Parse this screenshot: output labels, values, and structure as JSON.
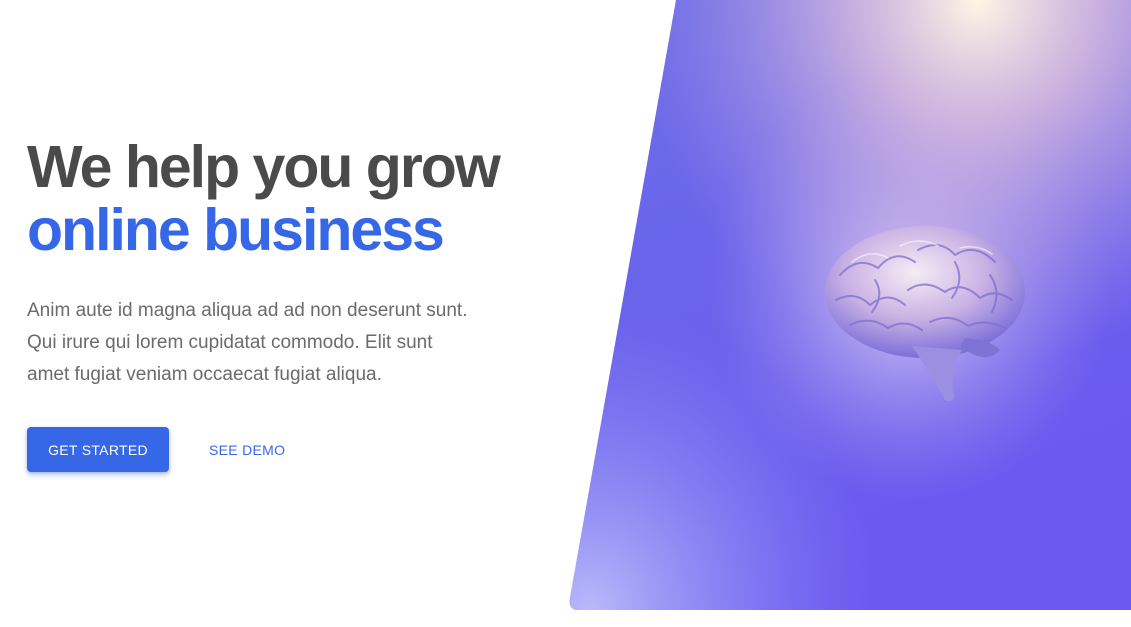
{
  "hero": {
    "headline_line1": "We help you grow",
    "headline_line2": "online business",
    "description": "Anim aute id magna aliqua ad ad non deserunt sunt. Qui irure qui lorem cupidatat commodo. Elit sunt amet fugiat veniam occaecat fugiat aliqua.",
    "primary_cta": "GET STARTED",
    "secondary_cta": "SEE DEMO",
    "image_subject": "brain-illustration"
  },
  "colors": {
    "accent": "#3567e6",
    "heading": "#4a4a4a",
    "body_text": "#6b6b6b",
    "image_purple": "#6a5ef0",
    "image_glow": "#fff2dc"
  }
}
